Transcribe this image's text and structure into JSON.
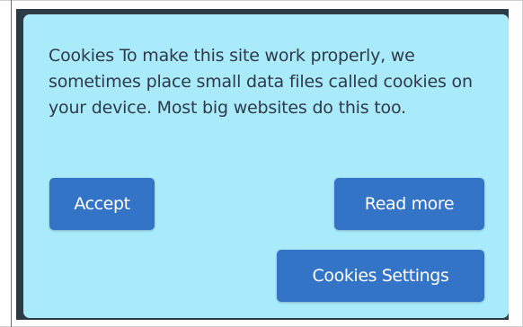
{
  "cookie_banner": {
    "message": "Cookies To make this site work properly, we sometimes place small data files called cookies on your device. Most big websites do this too.",
    "accept_label": "Accept",
    "read_more_label": "Read more",
    "settings_label": "Cookies Settings"
  },
  "colors": {
    "banner_background": "#a9ebfb",
    "button_background": "#3474c7",
    "button_text": "#ffffff",
    "message_text": "#2f3a48",
    "backdrop": "#2b3a45"
  }
}
